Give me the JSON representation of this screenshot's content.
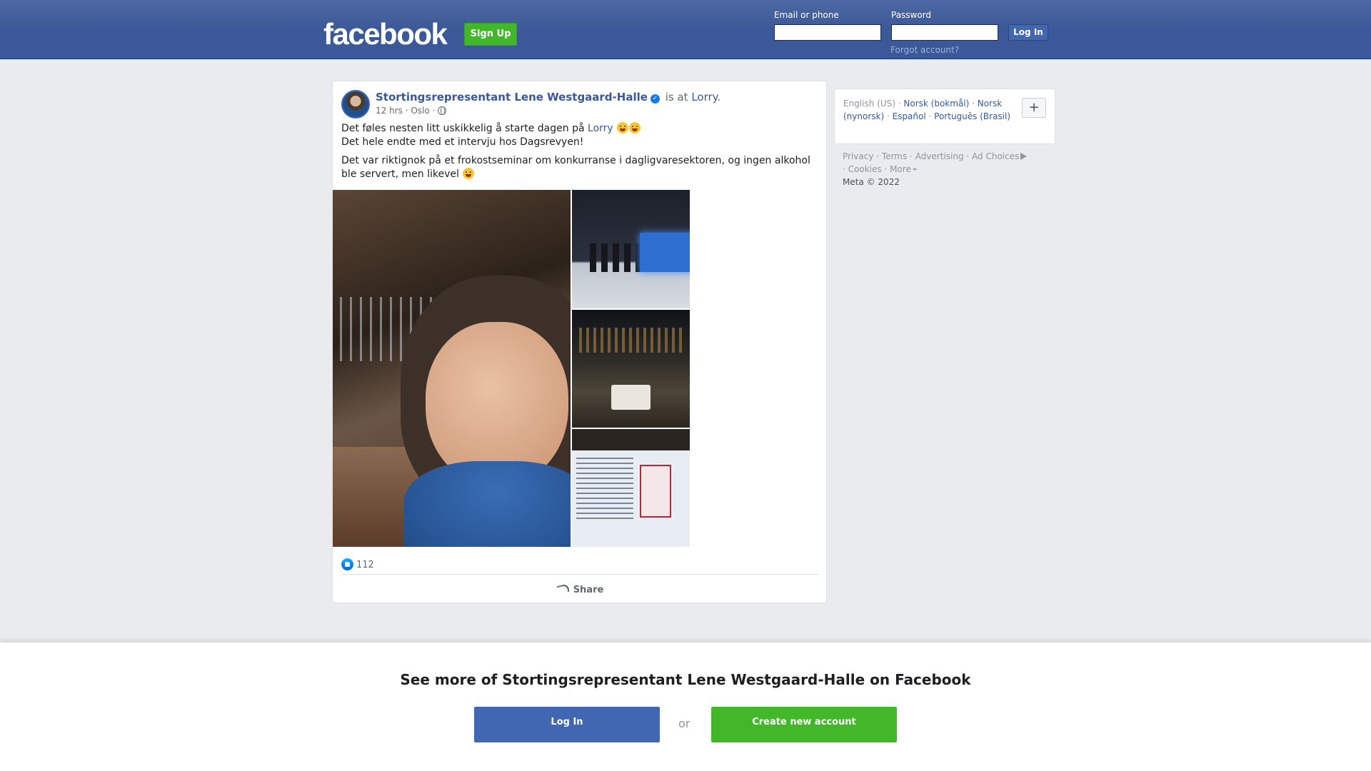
{
  "header": {
    "logo": "facebook",
    "signup_label": "Sign Up",
    "email_label": "Email or phone",
    "password_label": "Password",
    "email_value": "",
    "password_value": "",
    "login_label": "Log In",
    "forgot_label": "Forgot account?"
  },
  "post": {
    "author": "Stortingsrepresentant Lene Westgaard-Halle",
    "is_at": "is at",
    "place": "Lorry",
    "place_suffix": ".",
    "time": "12 hrs",
    "location": "Oslo",
    "dot": "·",
    "text_line1_a": "Det føles nesten litt uskikkelig å starte dagen på",
    "text_line1_link": "Lorry",
    "text_line2": "Det hele endte med et intervju hos Dagsrevyen!",
    "text_para2": "Det var riktignok på et frokostseminar om konkurranse i dagligvaresektoren, og ingen alkohol ble servert, men likevel",
    "likes_count": "112",
    "share_label": "Share"
  },
  "languages": {
    "current": "English (US)",
    "items": [
      "Norsk (bokmål)",
      "Norsk (nynorsk)",
      "Español",
      "Português (Brasil)"
    ],
    "plus_label": "+"
  },
  "footer": {
    "links": [
      "Privacy",
      "Terms",
      "Advertising",
      "Ad Choices",
      "Cookies",
      "More"
    ],
    "copyright": "Meta © 2022"
  },
  "banner": {
    "title": "See more of Stortingsrepresentant Lene Westgaard-Halle on Facebook",
    "login_label": "Log In",
    "or_label": "or",
    "create_label": "Create new account"
  },
  "colors": {
    "header_blue": "#3b5998",
    "link_blue": "#385898",
    "green": "#42b72a",
    "button_blue": "#4267b2"
  }
}
